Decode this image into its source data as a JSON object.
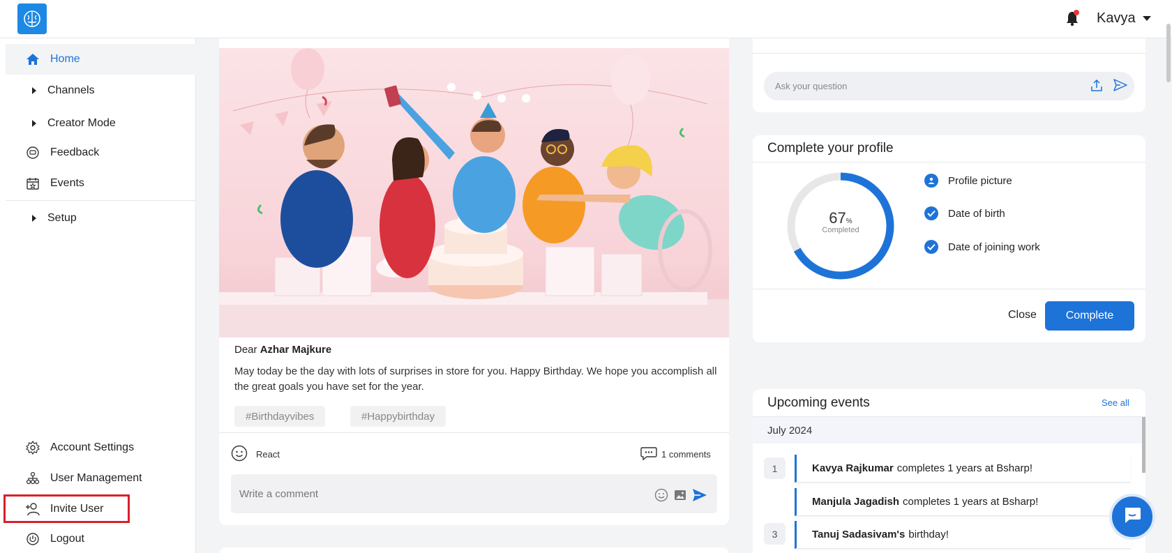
{
  "header": {
    "user_name": "Kavya"
  },
  "sidebar": {
    "items": [
      {
        "label": "Home"
      },
      {
        "label": "Channels"
      },
      {
        "label": "Creator Mode"
      },
      {
        "label": "Feedback"
      },
      {
        "label": "Events"
      },
      {
        "label": "Setup"
      }
    ],
    "bottom_items": [
      {
        "label": "Account Settings"
      },
      {
        "label": "User Management"
      },
      {
        "label": "Invite User"
      },
      {
        "label": "Logout"
      }
    ]
  },
  "post": {
    "salutation": "Dear",
    "recipient": "Azhar Majkure",
    "message": "May today be the day with lots of surprises in store for you. Happy Birthday. We hope you accomplish all the great goals you have set for the year.",
    "tags": [
      "#Birthdayvibes",
      "#Happybirthday"
    ],
    "react_label": "React",
    "comments_label": "1 comments",
    "comment_placeholder": "Write a comment"
  },
  "ask": {
    "placeholder": "Ask your question"
  },
  "profile": {
    "title": "Complete your profile",
    "percent": "67",
    "percent_symbol": "%",
    "percent_value": 67,
    "completed_label": "Completed",
    "items": [
      "Profile picture",
      "Date of birth",
      "Date of joining work"
    ],
    "close_label": "Close",
    "complete_label": "Complete"
  },
  "events": {
    "title": "Upcoming events",
    "see_all": "See all",
    "month": "July 2024",
    "items": [
      {
        "num": "1",
        "name": "Kavya Rajkumar",
        "text": "completes 1 years at Bsharp!"
      },
      {
        "num": "",
        "name": "Manjula Jagadish",
        "text": "completes 1 years at Bsharp!"
      },
      {
        "num": "3",
        "name": "Tanuj Sadasivam's",
        "text": "birthday!"
      }
    ]
  },
  "colors": {
    "accent": "#1e73d8",
    "highlight_box": "#d9202b"
  }
}
